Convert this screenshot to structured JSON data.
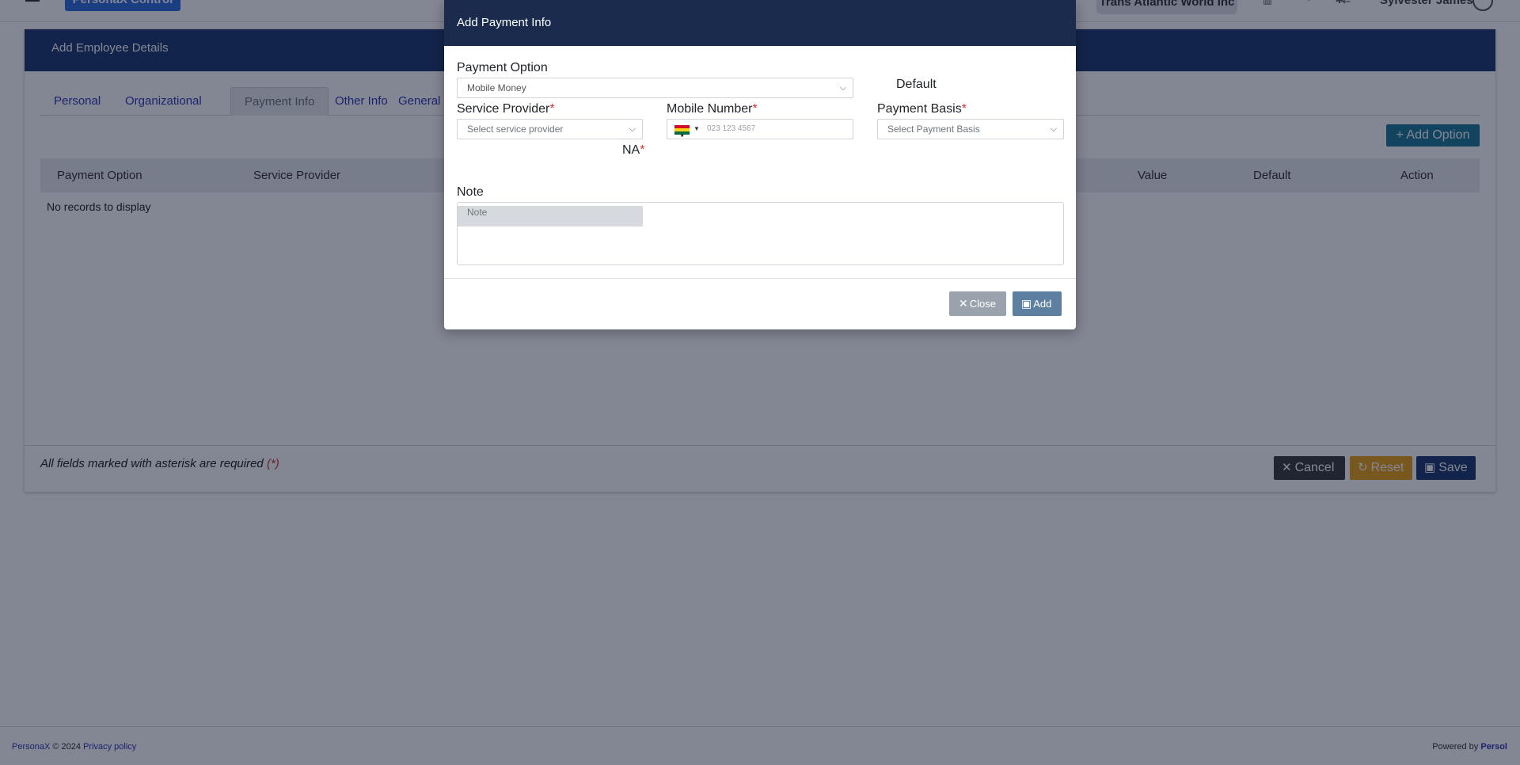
{
  "topbar": {
    "brand_label": "PersonaX Control",
    "company_name": "Trans Atlantic World Inc",
    "user_name": "Sylvester James"
  },
  "page": {
    "header_title": "Add Employee Details",
    "tabs": [
      {
        "label": "Personal"
      },
      {
        "label": "Organizational"
      },
      {
        "label": "Payment Info"
      },
      {
        "label": "Other Info"
      },
      {
        "label": "General"
      }
    ],
    "add_option_label": "+ Add Option",
    "table_headers": [
      "Payment Option",
      "Service Provider",
      "Value",
      "Default",
      "Action"
    ],
    "empty_message": "No records to display",
    "required_note": "All fields marked with asterisk are required",
    "required_marker": "(*)",
    "buttons": {
      "cancel": "Cancel",
      "reset": "Reset",
      "save": "Save"
    }
  },
  "colors": {
    "header_bg": "#1c3a6e",
    "cancel": "#3a3a3a",
    "reset": "#e8a317",
    "save": "#1c3a6e",
    "add_option": "#1e7a97",
    "modal_header": "#1a2b4d"
  },
  "modal": {
    "title": "Add Payment Info",
    "payment_option_label": "Payment Option",
    "payment_option_value": "Mobile Money",
    "default_label": "Default",
    "default_checked": false,
    "service_provider_label": "Service Provider",
    "service_provider_placeholder": "Select service provider",
    "mobile_number_label": "Mobile Number",
    "mobile_number_placeholder": "023 123 4567",
    "payment_basis_label": "Payment Basis",
    "payment_basis_placeholder": "Select Payment Basis",
    "na_label": "NA",
    "required_star": "*",
    "note_label": "Note",
    "note_placeholder": "Note",
    "close_label": "Close",
    "add_label": "Add"
  },
  "footer": {
    "app_name": "PersonaX",
    "copyright": " © 2024 ",
    "privacy_link": "Privacy policy",
    "powered_by": "Powered by ",
    "vendor": "Persol"
  }
}
